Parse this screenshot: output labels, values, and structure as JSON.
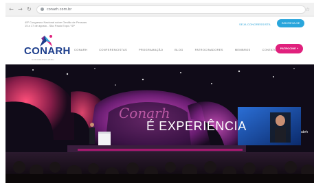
{
  "browser": {
    "back_icon": "arrow-left-icon",
    "forward_icon": "arrow-right-icon",
    "reload_icon": "reload-icon",
    "url": "conarh.com.br",
    "bookmark_icon": "star-icon"
  },
  "infobar": {
    "event_line1": "45º Congresso Nacional sobre Gestão de Pessoas",
    "event_line2": "15 a 17 de agosto - São Paulo Expo / SP",
    "link_label": "SEJA CONGRESSISTA",
    "cta_label": "INSCREVA-SE"
  },
  "header": {
    "logo_text": "CONARH",
    "logo_sub": "CONGRESSO ABRH",
    "nav": [
      "CONARH",
      "CONFERENCISTAS",
      "PROGRAMAÇÃO",
      "BLOG",
      "PATROCINADORES",
      "MEMBROS",
      "CONTATO"
    ],
    "cta_label": "PATROCINE +"
  },
  "hero": {
    "headline": "É EXPERIÊNCIA",
    "stage_sign": "Conarh",
    "screen_logo": "abrh"
  },
  "colors": {
    "brand_blue": "#1d3e8c",
    "accent_cyan": "#2aa6dc",
    "accent_magenta": "#e0217d"
  }
}
